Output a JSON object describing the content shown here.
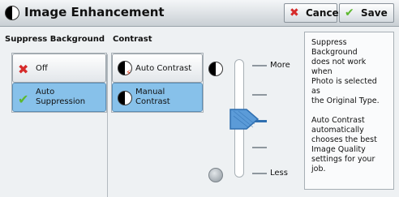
{
  "header": {
    "title": "Image Enhancement",
    "cancel_label": "Cancel",
    "save_label": "Save"
  },
  "suppress": {
    "heading": "Suppress Background",
    "options": [
      {
        "label": "Off",
        "icon": "x-icon",
        "selected": false
      },
      {
        "label": "Auto\nSuppression",
        "icon": "check-icon",
        "selected": true
      }
    ]
  },
  "contrast": {
    "heading": "Contrast",
    "options": [
      {
        "label": "Auto Contrast",
        "icon": "auto-contrast-icon",
        "selected": false
      },
      {
        "label": "Manual\nContrast",
        "icon": "manual-contrast-icon",
        "selected": true
      }
    ],
    "slider": {
      "top_label": "More",
      "bottom_label": "Less",
      "levels": 5,
      "selected_level": 3
    }
  },
  "help_text": "Suppress\nBackground\ndoes not work when\nPhoto is selected as\nthe Original Type.\n\nAuto Contrast\nautomatically\nchooses the best\nImage Quality\nsettings for your job.",
  "colors": {
    "selected": "#87c1ea",
    "cancel_icon": "#d62b2b",
    "save_icon": "#5cb82e",
    "slider_thumb": "#5b9bd8"
  }
}
